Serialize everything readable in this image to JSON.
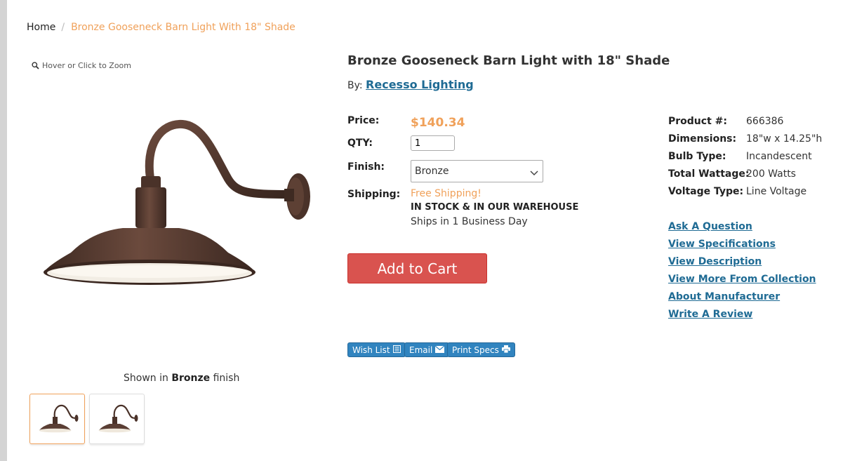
{
  "breadcrumb": {
    "home": "Home",
    "separator": "/",
    "current": "Bronze Gooseneck Barn Light With 18\" Shade"
  },
  "gallery": {
    "zoom_hint": "Hover or Click to Zoom",
    "shown_in_prefix": "Shown in",
    "shown_in_finish": "Bronze",
    "shown_in_suffix": "finish"
  },
  "product": {
    "title": "Bronze Gooseneck Barn Light with 18\" Shade",
    "by_label": "By:",
    "brand": "Recesso Lighting"
  },
  "purchase": {
    "price_label": "Price:",
    "price": "$140.34",
    "qty_label": "QTY:",
    "qty_value": "1",
    "finish_label": "Finish:",
    "finish_value": "Bronze",
    "shipping_label": "Shipping:",
    "shipping_free": "Free Shipping!",
    "shipping_stock": "IN STOCK & IN OUR WAREHOUSE",
    "shipping_days": "Ships in 1 Business Day",
    "add_to_cart": "Add to Cart"
  },
  "actions": {
    "wish_list": "Wish List",
    "email": "Email",
    "print_specs": "Print Specs"
  },
  "specs": [
    {
      "label": "Product #:",
      "value": "666386"
    },
    {
      "label": "Dimensions:",
      "value": "18\"w x 14.25\"h"
    },
    {
      "label": "Bulb Type:",
      "value": "Incandescent"
    },
    {
      "label": "Total Wattage:",
      "value": "200 Watts"
    },
    {
      "label": "Voltage Type:",
      "value": "Line Voltage"
    }
  ],
  "links": [
    "Ask A Question",
    "View Specifications",
    "View Description",
    "View More From Collection",
    "About Manufacturer",
    "Write A Review"
  ],
  "colors": {
    "accent_orange": "#f0a15a",
    "link_blue": "#1f6b94",
    "cart_red": "#d9534f",
    "button_blue": "#3184bf",
    "lamp_bronze": "#5a3e34"
  }
}
